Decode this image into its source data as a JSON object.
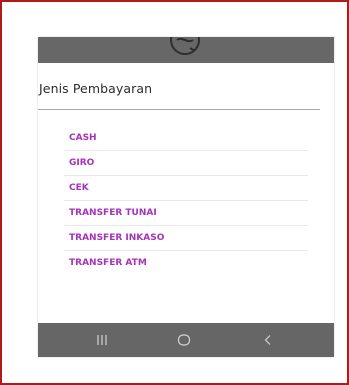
{
  "dialog": {
    "title": "Jenis Pembayaran",
    "options": [
      {
        "label": "CASH"
      },
      {
        "label": "GIRO"
      },
      {
        "label": "CEK"
      },
      {
        "label": "TRANSFER TUNAI"
      },
      {
        "label": "TRANSFER INKASO"
      },
      {
        "label": "TRANSFER ATM"
      }
    ]
  },
  "icons": {
    "top": "no-entry-circle-icon",
    "recents": "recent-apps-icon",
    "home": "home-circle-icon",
    "back": "back-chevron-icon"
  },
  "colors": {
    "frame_border": "#b01a1a",
    "dark_bar": "#666666",
    "option_text": "#a533b8",
    "title_text": "#2b2b2b",
    "divider": "#a6a6a6"
  }
}
